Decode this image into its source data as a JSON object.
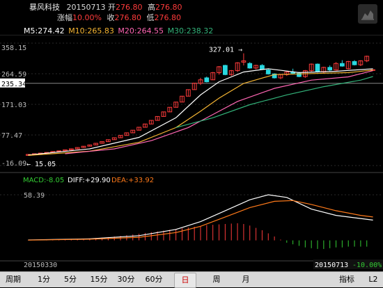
{
  "stock": {
    "name": "暴风科技",
    "date": "20150713",
    "open_label": "开",
    "open": "276.80",
    "high_label": "高",
    "high": "276.80",
    "change_label": "涨幅",
    "change": "10.00%",
    "close_label": "收",
    "close": "276.80",
    "low_label": "低",
    "low": "276.80"
  },
  "ma": {
    "m5": "M5:274.42",
    "m10": "M10:265.83",
    "m20": "M20:264.55",
    "m30": "M30:238.32"
  },
  "price_axis": [
    "358.15",
    "264.59",
    "235.34",
    "171.03",
    "77.47",
    "-16.09"
  ],
  "annotations": {
    "peak": "327.01",
    "low": "15.05"
  },
  "macd": {
    "macd": "MACD:-8.05",
    "diff": "DIFF:+29.90",
    "dea": "DEA:+33.92",
    "ytop": "58.39"
  },
  "footer": {
    "start_date": "20150330",
    "end_date": "20150713",
    "end_change": "-10.00%"
  },
  "tabs": [
    "周期",
    "1分",
    "5分",
    "15分",
    "30分",
    "60分",
    "日",
    "周",
    "月"
  ],
  "active_tab": "日",
  "right_tabs": [
    "指标",
    "L2"
  ],
  "colors": {
    "up": "#ff3b3b",
    "down": "#29d8e0",
    "ma5": "#ffffff",
    "ma10": "#f5b533",
    "ma20": "#ff66b3",
    "ma30": "#33b37a",
    "diff": "#ffffff",
    "dea": "#ff7a1a"
  },
  "chart_data": {
    "type": "candlestick",
    "y_range": [
      -16.09,
      358.15
    ],
    "candles": [
      [
        15.05,
        18,
        15,
        18
      ],
      [
        18,
        20,
        18,
        20
      ],
      [
        20,
        22,
        20,
        22
      ],
      [
        22,
        24,
        22,
        24
      ],
      [
        24,
        27,
        24,
        27
      ],
      [
        27,
        29,
        27,
        29
      ],
      [
        29,
        32,
        29,
        32
      ],
      [
        32,
        35,
        32,
        35
      ],
      [
        35,
        39,
        35,
        39
      ],
      [
        39,
        43,
        39,
        43
      ],
      [
        43,
        47,
        43,
        47
      ],
      [
        47,
        52,
        47,
        52
      ],
      [
        52,
        57,
        52,
        57
      ],
      [
        57,
        63,
        57,
        63
      ],
      [
        63,
        69,
        63,
        69
      ],
      [
        69,
        76,
        69,
        76
      ],
      [
        76,
        84,
        76,
        84
      ],
      [
        84,
        92,
        84,
        92
      ],
      [
        92,
        101,
        92,
        101
      ],
      [
        101,
        111,
        101,
        111
      ],
      [
        111,
        122,
        111,
        122
      ],
      [
        122,
        134,
        122,
        134
      ],
      [
        134,
        148,
        134,
        148
      ],
      [
        148,
        162,
        148,
        162
      ],
      [
        162,
        178,
        162,
        178
      ],
      [
        178,
        196,
        178,
        196
      ],
      [
        196,
        216,
        196,
        216
      ],
      [
        216,
        236,
        216,
        236
      ],
      [
        236,
        252,
        230,
        246
      ],
      [
        252,
        256,
        238,
        240
      ],
      [
        246,
        270,
        245,
        268
      ],
      [
        268,
        288,
        262,
        286
      ],
      [
        290,
        292,
        260,
        262
      ],
      [
        262,
        276,
        258,
        274
      ],
      [
        274,
        300,
        270,
        298
      ],
      [
        300,
        327.01,
        290,
        304
      ],
      [
        296,
        300,
        280,
        282
      ],
      [
        282,
        292,
        278,
        290
      ],
      [
        290,
        294,
        276,
        278
      ],
      [
        276,
        280,
        262,
        264
      ],
      [
        264,
        266,
        250,
        252
      ],
      [
        252,
        264,
        248,
        262
      ],
      [
        262,
        272,
        258,
        270
      ],
      [
        270,
        280,
        262,
        266
      ],
      [
        266,
        270,
        254,
        256
      ],
      [
        256,
        276,
        252,
        274
      ],
      [
        274,
        296,
        270,
        294
      ],
      [
        294,
        296,
        268,
        270
      ],
      [
        270,
        286,
        266,
        284
      ],
      [
        284,
        290,
        272,
        276
      ],
      [
        276,
        300,
        274,
        296
      ],
      [
        296,
        306,
        286,
        288
      ],
      [
        280,
        304,
        278,
        302
      ],
      [
        302,
        306,
        290,
        292
      ],
      [
        292,
        306,
        288,
        304
      ],
      [
        304,
        320,
        300,
        318
      ],
      [
        276.8,
        276.8,
        276.8,
        276.8
      ]
    ],
    "ma_lines": {
      "M5": [
        [
          0,
          16
        ],
        [
          10,
          35
        ],
        [
          18,
          70
        ],
        [
          24,
          130
        ],
        [
          28,
          200
        ],
        [
          31,
          240
        ],
        [
          35,
          270
        ],
        [
          39,
          280
        ],
        [
          44,
          268
        ],
        [
          50,
          272
        ],
        [
          56,
          280
        ]
      ],
      "M10": [
        [
          0,
          15
        ],
        [
          10,
          28
        ],
        [
          18,
          55
        ],
        [
          24,
          100
        ],
        [
          28,
          150
        ],
        [
          31,
          190
        ],
        [
          35,
          235
        ],
        [
          40,
          262
        ],
        [
          46,
          265
        ],
        [
          52,
          268
        ],
        [
          56,
          276
        ]
      ],
      "M20": [
        [
          6,
          20
        ],
        [
          14,
          35
        ],
        [
          20,
          60
        ],
        [
          26,
          100
        ],
        [
          30,
          140
        ],
        [
          34,
          180
        ],
        [
          40,
          220
        ],
        [
          46,
          245
        ],
        [
          52,
          255
        ],
        [
          56,
          274
        ]
      ],
      "M30": [
        [
          24,
          100
        ],
        [
          30,
          130
        ],
        [
          36,
          170
        ],
        [
          42,
          200
        ],
        [
          48,
          225
        ],
        [
          54,
          245
        ],
        [
          56,
          256
        ]
      ]
    },
    "macd_range": [
      -20,
      58.39
    ],
    "diff_line": [
      [
        0,
        0.5
      ],
      [
        10,
        2
      ],
      [
        18,
        6
      ],
      [
        24,
        14
      ],
      [
        28,
        24
      ],
      [
        32,
        38
      ],
      [
        36,
        52
      ],
      [
        39,
        58.39
      ],
      [
        42,
        55
      ],
      [
        46,
        40
      ],
      [
        50,
        32
      ],
      [
        54,
        28
      ],
      [
        56,
        26
      ]
    ],
    "dea_line": [
      [
        0,
        0.3
      ],
      [
        10,
        1.5
      ],
      [
        18,
        4
      ],
      [
        24,
        10
      ],
      [
        28,
        18
      ],
      [
        32,
        30
      ],
      [
        36,
        42
      ],
      [
        40,
        50
      ],
      [
        43,
        51
      ],
      [
        46,
        46
      ],
      [
        50,
        38
      ],
      [
        54,
        32
      ],
      [
        56,
        30
      ]
    ],
    "macd_bars": [
      0.2,
      0.3,
      0.4,
      0.5,
      0.6,
      0.8,
      1,
      1.3,
      1.6,
      2,
      2.5,
      3,
      3.6,
      4.2,
      5,
      5.8,
      6.6,
      7.5,
      8.5,
      9.5,
      10.5,
      11.5,
      12.5,
      13.5,
      14.5,
      15.5,
      16.5,
      17.5,
      18.5,
      19.5,
      20,
      20.5,
      21,
      21.5,
      22,
      21,
      19,
      16,
      13,
      9,
      5,
      1,
      -3,
      -5,
      -7,
      -9,
      -10,
      -11,
      -11,
      -10,
      -9,
      -9,
      -8,
      -8,
      -8,
      -8.05
    ]
  }
}
